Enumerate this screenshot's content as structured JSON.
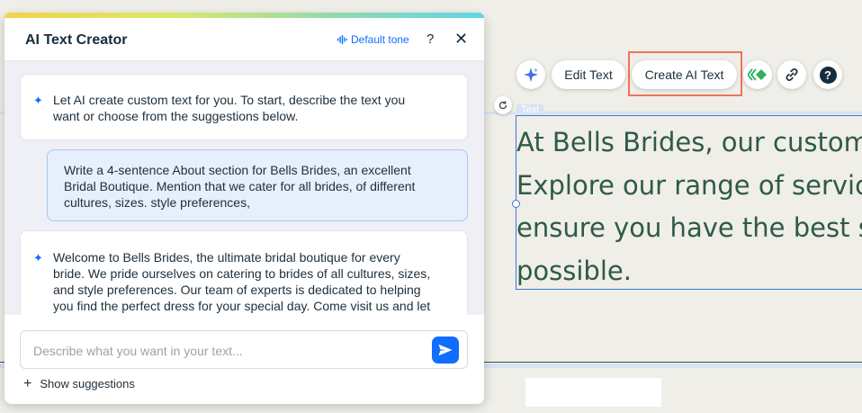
{
  "panel": {
    "title": "AI Text Creator",
    "tone_label": "Default tone",
    "help_label": "?",
    "close_label": "✕"
  },
  "messages": [
    {
      "role": "ai",
      "text": "Let AI create custom text for you. To start, describe the text you\nwant or choose from the suggestions below."
    },
    {
      "role": "user",
      "text": "Write a 4-sentence About section for Bells Brides, an excellent\nBridal Boutique. Mention that we cater for all brides, of different\ncultures, sizes. style preferences,"
    },
    {
      "role": "ai",
      "text": "Welcome to Bells Brides, the ultimate bridal boutique for every\nbride. We pride ourselves on catering to brides of all cultures, sizes,\nand style preferences. Our team of experts is dedicated to helping\nyou find the perfect dress for your special day. Come visit us and let"
    }
  ],
  "composer": {
    "placeholder": "Describe what you want in your text...",
    "show_suggestions": "Show suggestions"
  },
  "toolbar": {
    "edit_text": "Edit Text",
    "create_ai_text": "Create AI Text",
    "help_label": "?"
  },
  "canvas": {
    "element_tag": "Text",
    "lines": [
      "At Bells Brides, our custom",
      "Explore our range of servic",
      "ensure you have the best s",
      "possible."
    ]
  },
  "colors": {
    "accent": "#116dff",
    "highlight": "#f0745a",
    "canvas_text": "#2f5a46",
    "selection": "#3a7bd5"
  }
}
